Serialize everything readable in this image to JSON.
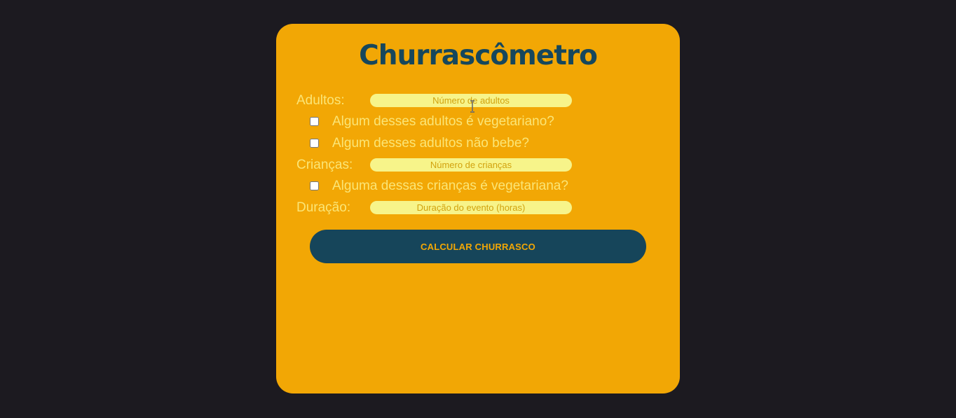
{
  "app": {
    "title": "Churrascômetro"
  },
  "form": {
    "adults": {
      "label": "Adultos:",
      "placeholder": "Número de adultos",
      "value": ""
    },
    "adults_vegetarian": {
      "label": "Algum desses adultos é vegetariano?",
      "checked": false
    },
    "adults_no_drink": {
      "label": "Algum desses adultos não bebe?",
      "checked": false
    },
    "children": {
      "label": "Crianças:",
      "placeholder": "Número de crianças",
      "value": ""
    },
    "children_vegetarian": {
      "label": "Alguma dessas crianças é vegetariana?",
      "checked": false
    },
    "duration": {
      "label": "Duração:",
      "placeholder": "Duração do evento (horas)",
      "value": ""
    },
    "calculate_label": "CALCULAR CHURRASCO"
  },
  "colors": {
    "page_background": "#1c1a20",
    "card_background": "#f2a705",
    "title": "#16475c",
    "label": "#fbe576",
    "field_background": "#f7f48a",
    "button_background": "#16455a",
    "button_text": "#f2a705"
  },
  "icons": {
    "cursor": "text-cursor-icon"
  }
}
